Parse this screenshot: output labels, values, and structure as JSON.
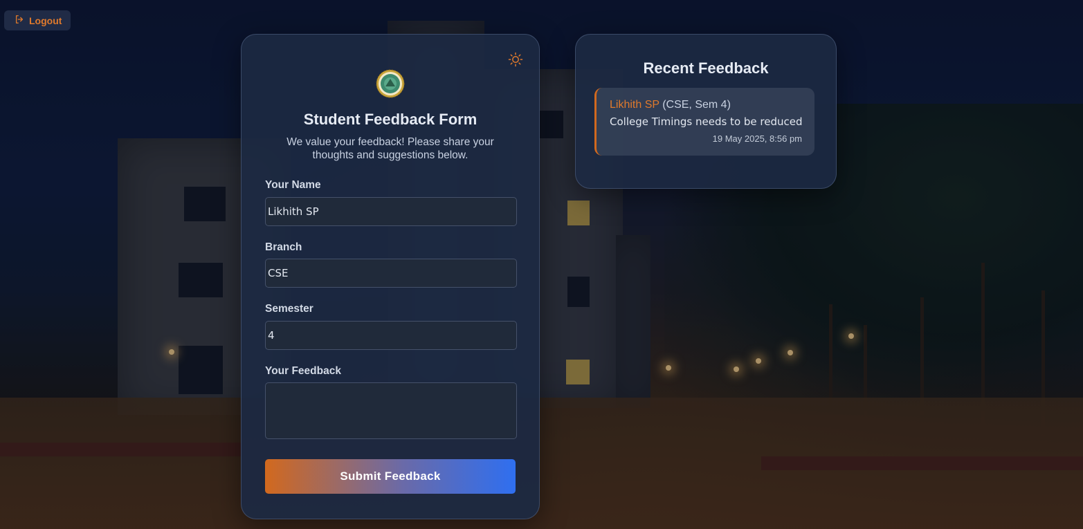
{
  "header": {
    "logout_label": "Logout"
  },
  "form": {
    "title": "Student Feedback Form",
    "subtitle": "We value your feedback! Please share your thoughts and suggestions below.",
    "fields": {
      "name": {
        "label": "Your Name",
        "value": "Likhith SP"
      },
      "branch": {
        "label": "Branch",
        "value": "CSE"
      },
      "semester": {
        "label": "Semester",
        "value": "4"
      },
      "feedback": {
        "label": "Your Feedback",
        "value": ""
      }
    },
    "submit_label": "Submit Feedback"
  },
  "recent": {
    "title": "Recent Feedback",
    "items": [
      {
        "name": "Likhith SP",
        "meta": "(CSE, Sem 4)",
        "text": "College Timings needs to be reduced",
        "time": "19 May 2025, 8:56 pm"
      }
    ]
  },
  "colors": {
    "accent_orange": "#d2691e",
    "accent_blue": "#2f6ff0",
    "card_bg": "#1c2942"
  },
  "icons": {
    "logout": "logout-icon",
    "theme": "sun-icon",
    "logo": "college-emblem"
  }
}
